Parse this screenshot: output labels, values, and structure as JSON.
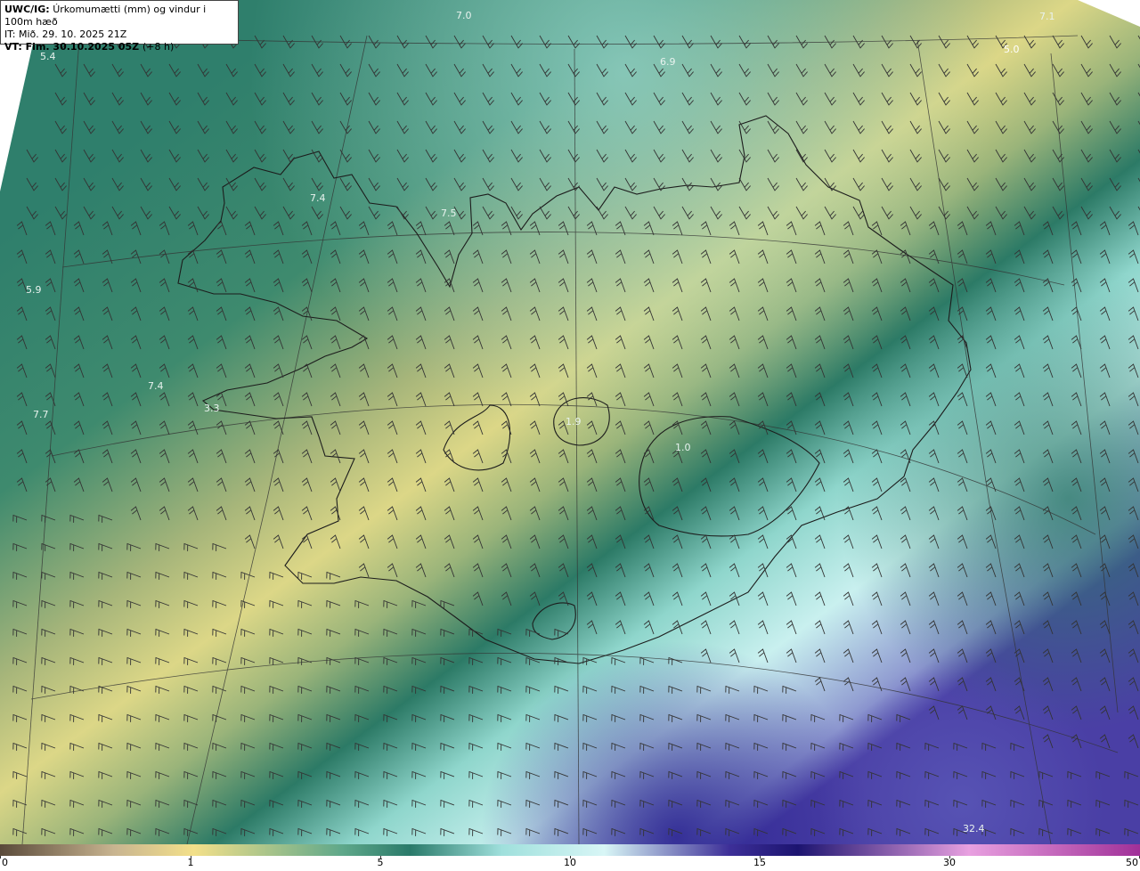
{
  "header": {
    "product": "UWC/IG:",
    "description": "Úrkomumætti (mm) og vindur i 100m hæð",
    "init_time": "IT: Mið. 29. 10. 2025 21Z",
    "valid_time_label": "VT:",
    "valid_time": "Fim. 30.10.2025 05Z",
    "lead_time": "(+8 h)"
  },
  "map": {
    "value_labels": [
      {
        "text": "7.0"
      },
      {
        "text": "7.1"
      },
      {
        "text": "5.0"
      },
      {
        "text": "6.9"
      },
      {
        "text": "5.4"
      },
      {
        "text": "7.5"
      },
      {
        "text": "7.4"
      },
      {
        "text": "5.9"
      },
      {
        "text": "7.4"
      },
      {
        "text": "7.7"
      },
      {
        "text": "3.3"
      },
      {
        "text": "1.9"
      },
      {
        "text": "1.0"
      },
      {
        "text": "32.4"
      }
    ]
  },
  "legend": {
    "ticks": [
      "0",
      "1",
      "5",
      "10",
      "15",
      "30",
      "50"
    ],
    "colors": [
      "#5a4a3a",
      "#c8b490",
      "#f3e08a",
      "#5fa88a",
      "#2a7a6a",
      "#9fe0dc",
      "#d8f6f6",
      "#3d2f98",
      "#1c1470",
      "#e8a0e0",
      "#a03098"
    ]
  }
}
